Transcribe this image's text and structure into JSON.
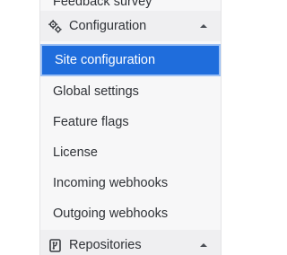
{
  "sidebar": {
    "partial_item": "Feedback survey",
    "configuration": {
      "label": "Configuration",
      "icon": "gears-icon",
      "expanded": true,
      "items": [
        {
          "label": "Site configuration",
          "active": true
        },
        {
          "label": "Global settings",
          "active": false
        },
        {
          "label": "Feature flags",
          "active": false
        },
        {
          "label": "License",
          "active": false
        },
        {
          "label": "Incoming webhooks",
          "active": false
        },
        {
          "label": "Outgoing webhooks",
          "active": false
        }
      ]
    },
    "repositories": {
      "label": "Repositories",
      "icon": "repository-icon",
      "expanded": true
    }
  },
  "colors": {
    "active_bg": "#1f6ddc",
    "section_bg": "#efeff1",
    "sidebar_bg": "#f7f7f8"
  }
}
